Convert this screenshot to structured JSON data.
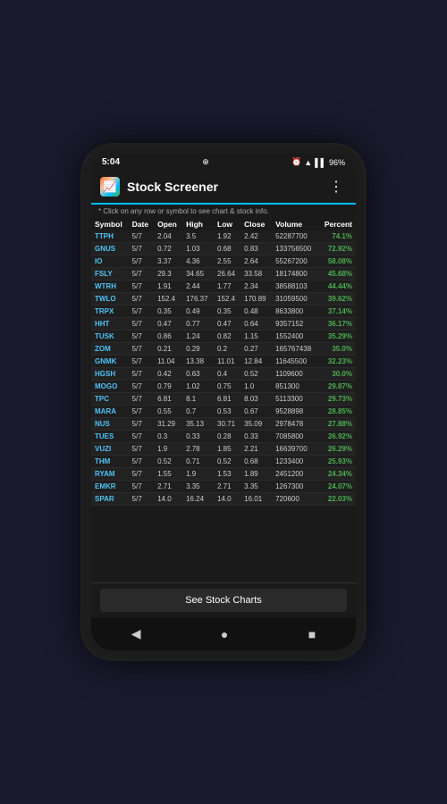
{
  "statusBar": {
    "time": "5:04",
    "alarm": "⏰",
    "battery": "96%",
    "icons": "⊕ ▲ ▌▌ 96%"
  },
  "header": {
    "title": "Stock Screener",
    "iconLabel": "📈",
    "menuLabel": "⋮"
  },
  "infoText": "* Click on any row or symbol to see chart & stock info.",
  "table": {
    "columns": [
      "Symbol",
      "Date",
      "Open",
      "High",
      "Low",
      "Close",
      "Volume",
      "Percent"
    ],
    "rows": [
      [
        "TTPH",
        "5/7",
        "2.04",
        "3.5",
        "1.92",
        "2.42",
        "52287700",
        "74.1%"
      ],
      [
        "GNUS",
        "5/7",
        "0.72",
        "1.03",
        "0.68",
        "0.83",
        "133756500",
        "72.92%"
      ],
      [
        "IO",
        "5/7",
        "3.37",
        "4.36",
        "2.55",
        "2.64",
        "55267200",
        "58.08%"
      ],
      [
        "FSLY",
        "5/7",
        "29.3",
        "34.65",
        "26.64",
        "33.58",
        "18174800",
        "45.68%"
      ],
      [
        "WTRH",
        "5/7",
        "1.91",
        "2.44",
        "1.77",
        "2.34",
        "38588103",
        "44.44%"
      ],
      [
        "TWLO",
        "5/7",
        "152.4",
        "176.37",
        "152.4",
        "170.89",
        "31059500",
        "39.62%"
      ],
      [
        "TRPX",
        "5/7",
        "0.35",
        "0.49",
        "0.35",
        "0.48",
        "8633800",
        "37.14%"
      ],
      [
        "HHT",
        "5/7",
        "0.47",
        "0.77",
        "0.47",
        "0.64",
        "9357152",
        "36.17%"
      ],
      [
        "TUSK",
        "5/7",
        "0.86",
        "1.24",
        "0.82",
        "1.15",
        "1552400",
        "35.29%"
      ],
      [
        "ZOM",
        "5/7",
        "0.21",
        "0.29",
        "0.2",
        "0.27",
        "165767438",
        "35.0%"
      ],
      [
        "GNMK",
        "5/7",
        "11.04",
        "13.38",
        "11.01",
        "12.84",
        "11645500",
        "32.23%"
      ],
      [
        "HGSH",
        "5/7",
        "0.42",
        "0.63",
        "0.4",
        "0.52",
        "1109600",
        "30.0%"
      ],
      [
        "MOGO",
        "5/7",
        "0.79",
        "1.02",
        "0.75",
        "1.0",
        "851300",
        "29.87%"
      ],
      [
        "TPC",
        "5/7",
        "6.81",
        "8.1",
        "6.81",
        "8.03",
        "5113300",
        "29.73%"
      ],
      [
        "MARA",
        "5/7",
        "0.55",
        "0.7",
        "0.53",
        "0.67",
        "9528898",
        "28.85%"
      ],
      [
        "NUS",
        "5/7",
        "31.29",
        "35.13",
        "30.71",
        "35.09",
        "2978478",
        "27.88%"
      ],
      [
        "TUES",
        "5/7",
        "0.3",
        "0.33",
        "0.28",
        "0.33",
        "7085800",
        "26.92%"
      ],
      [
        "VUZI",
        "5/7",
        "1.9",
        "2.78",
        "1.85",
        "2.21",
        "16639700",
        "26.29%"
      ],
      [
        "THM",
        "5/7",
        "0.52",
        "0.71",
        "0.52",
        "0.68",
        "1233400",
        "25.93%"
      ],
      [
        "RYAM",
        "5/7",
        "1.55",
        "1.9",
        "1.53",
        "1.89",
        "2451200",
        "24.34%"
      ],
      [
        "EMKR",
        "5/7",
        "2.71",
        "3.35",
        "2.71",
        "3.35",
        "1267300",
        "24.07%"
      ],
      [
        "SPAR",
        "5/7",
        "14.0",
        "16.24",
        "14.0",
        "16.01",
        "720600",
        "22.03%"
      ]
    ]
  },
  "button": {
    "label": "See Stock Charts"
  },
  "navBar": {
    "back": "◀",
    "home": "●",
    "recent": "■"
  }
}
